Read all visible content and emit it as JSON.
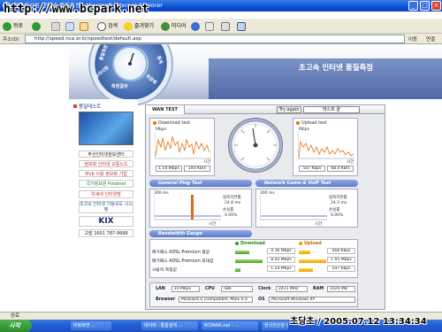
{
  "window": {
    "title": "한국전산원 인터넷 품질측정 - Microsoft Internet Explorer"
  },
  "watermark": "http://www.bcpark.net",
  "toolbar": {
    "back": "뒤로",
    "search": "검색",
    "favorites": "즐겨찾기",
    "media": "미디어"
  },
  "address": {
    "label": "주소(D)",
    "url": "http://speed.nca.or.kr/speedtest/default.asp",
    "go": "이동",
    "links": "연결"
  },
  "header": {
    "site_title": "초고속 인터넷 품질측정",
    "wheel_labels": [
      "품질측정",
      "유의사항",
      "측정결과",
      "측정예",
      "통계"
    ]
  },
  "left": {
    "title": "품질테스트",
    "banners": [
      "부산인터넷정보센터",
      "정보화 인터넷 교통노드",
      "IPv6 이용 정보화 기업",
      "국가정보원 Potalnet",
      "차세대 인터넷망",
      "초고속 인터넷 가용속도 시스템",
      "KIX",
      "고발 1601 787-9999"
    ]
  },
  "panel": {
    "tab": "WAN TEST",
    "try_again": "Try again",
    "test_field": "테스트 끝",
    "download": {
      "title": "Download test",
      "unit": "Mbps",
      "axis": "시간",
      "value1": "1.54 Mbps",
      "value2": "193 KB/s"
    },
    "upload": {
      "title": "Upload test",
      "unit": "Mbps",
      "axis": "시간",
      "value1": "547 Kbps",
      "value2": "68.4 KB/s"
    },
    "ping_section": "General Ping Test",
    "game_section": "Network Game & VoIP Test",
    "bandwidth_section": "Bandwidth Gauge",
    "ping": {
      "ms_label": "300 ms",
      "delay_label": "왕복지연률",
      "delay_value": "24.8 ms",
      "loss_label": "손실률",
      "loss_value": "4.00%",
      "axis": "시간"
    },
    "game": {
      "ms_label": "300 ms",
      "delay_label": "왕복지연률",
      "delay_value": "24.3 ms",
      "loss_label": "손실률",
      "loss_value": "0.00%",
      "axis": "시간"
    },
    "bandwidth": {
      "download_header": "Download",
      "upload_header": "Upload",
      "rows": [
        {
          "label": "메가패스 ADSL Premium 평균",
          "down": "4.36 Mbps",
          "up": "468 Kbps",
          "down_frac": 0.5,
          "up_frac": 0.42
        },
        {
          "label": "메가패스 ADSL Premium 최대값",
          "down": "8.42 Mbps",
          "up": "1.05 Mbps",
          "down_frac": 0.97,
          "up_frac": 0.97
        },
        {
          "label": "사용자 측정값",
          "down": "1.54 Mbps",
          "up": "547 Kbps",
          "down_frac": 0.18,
          "up_frac": 0.5
        }
      ]
    },
    "sysinfo": {
      "lan_label": "LAN",
      "lan": "10 Mbps",
      "cpu_label": "CPU",
      "cpu": "586",
      "clock_label": "Clock",
      "clock": "2411 MHz",
      "ram_label": "RAM",
      "ram": "1024 MB",
      "browser_label": "Browser",
      "browser": "Mozilla/4.0 (compatible; MSIE 6.0",
      "os_label": "OS",
      "os": "Microsoft Windows XP"
    }
  },
  "status": {
    "text": "완료"
  },
  "taskbar": {
    "start": "시작",
    "tasks": [
      "바탕화면 ...",
      "네이버 : 통합검색 ...",
      "BCPARK.net - ...",
      "한국전산원 인..."
    ]
  },
  "timestamp": "초당초 / 2005.07.12 13:34:34",
  "colors": {
    "accent": "#4f6aa8",
    "download_line": "#e07010",
    "upload_line": "#e07010",
    "ping_bar": "#e06a1a"
  }
}
